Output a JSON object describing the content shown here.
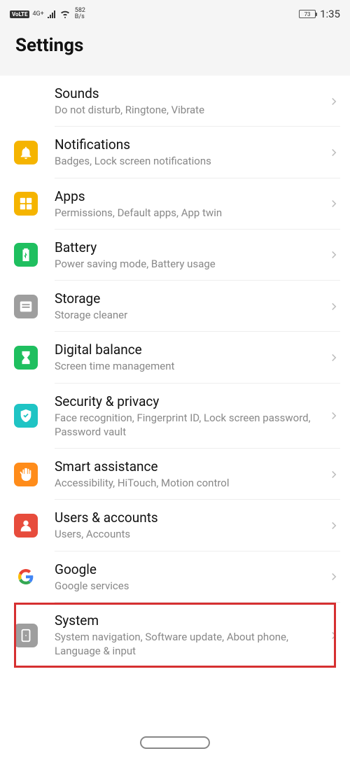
{
  "status": {
    "volte": "VoLTE",
    "network": "4G+",
    "speed_top": "582",
    "speed_bot": "B/s",
    "battery": "73",
    "time": "1:35"
  },
  "header": {
    "title": "Settings"
  },
  "items": [
    {
      "id": "sounds",
      "title": "Sounds",
      "sub": "Do not disturb, Ringtone, Vibrate",
      "color": "#7a5cf0"
    },
    {
      "id": "notifications",
      "title": "Notifications",
      "sub": "Badges, Lock screen notifications",
      "color": "#f5b400"
    },
    {
      "id": "apps",
      "title": "Apps",
      "sub": "Permissions, Default apps, App twin",
      "color": "#f5b400"
    },
    {
      "id": "battery",
      "title": "Battery",
      "sub": "Power saving mode, Battery usage",
      "color": "#1fbf5f"
    },
    {
      "id": "storage",
      "title": "Storage",
      "sub": "Storage cleaner",
      "color": "#9e9e9e"
    },
    {
      "id": "digital-balance",
      "title": "Digital balance",
      "sub": "Screen time management",
      "color": "#1fbf5f"
    },
    {
      "id": "security",
      "title": "Security & privacy",
      "sub": "Face recognition, Fingerprint ID, Lock screen password, Password vault",
      "color": "#1fc4c4"
    },
    {
      "id": "smart-assist",
      "title": "Smart assistance",
      "sub": "Accessibility, HiTouch, Motion control",
      "color": "#ff8c1a"
    },
    {
      "id": "users",
      "title": "Users & accounts",
      "sub": "Users, Accounts",
      "color": "#e74c3c"
    },
    {
      "id": "google",
      "title": "Google",
      "sub": "Google services",
      "color": "transparent"
    },
    {
      "id": "system",
      "title": "System",
      "sub": "System navigation, Software update, About phone, Language & input",
      "color": "#9e9e9e"
    }
  ]
}
